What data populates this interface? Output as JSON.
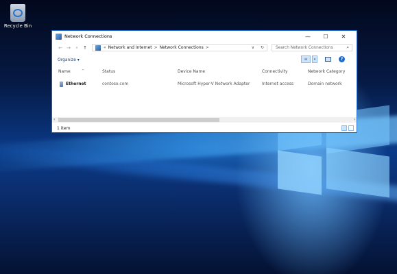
{
  "desktop": {
    "recycle_bin_label": "Recycle Bin"
  },
  "window": {
    "title": "Network Connections",
    "controls": {
      "minimize": "—",
      "maximize": "☐",
      "close": "✕"
    },
    "address": {
      "back": "←",
      "forward": "→",
      "up": "↑",
      "prefix": "«",
      "segments": [
        "Network and Internet",
        "Network Connections"
      ],
      "separator": ">",
      "dropdown": "∨",
      "refresh": "↻"
    },
    "search": {
      "placeholder": "Search Network Connections",
      "icon": "⌕"
    },
    "commandbar": {
      "organize": "Organize ▾",
      "help": "?"
    },
    "columns": [
      "Name",
      "Status",
      "Device Name",
      "Connectivity",
      "Network Category"
    ],
    "rows": [
      {
        "name": "Ethernet",
        "status": "contoso.com",
        "device": "Microsoft Hyper-V Network Adapter",
        "connectivity": "Internet access",
        "category": "Domain network"
      }
    ],
    "status_text": "1 item"
  },
  "colors": {
    "accent": "#1e6cc9",
    "desktop_blue": "#0a3a88"
  }
}
